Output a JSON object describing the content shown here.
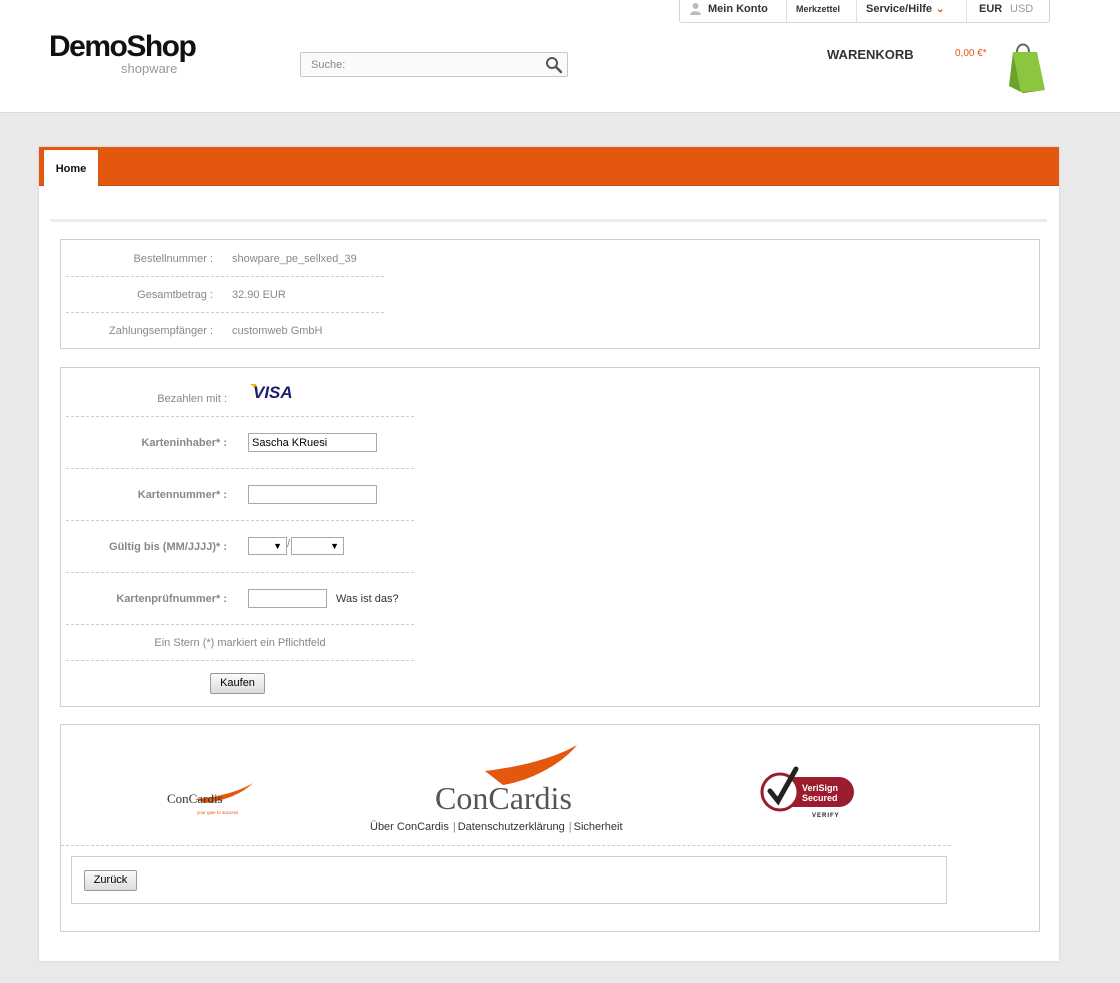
{
  "header": {
    "logo_main": "DemoShop",
    "logo_sub": "shopware",
    "search_placeholder": "Suche:",
    "account": "Mein Konto",
    "wishlist": "Merkzettel",
    "service": "Service/Hilfe",
    "currency_active": "EUR",
    "currency_other": "USD",
    "cart_label": "WARENKORB",
    "cart_amount": "0,00 €*"
  },
  "nav": {
    "home": "Home"
  },
  "order": {
    "rows": [
      {
        "label": "Bestellnummer :",
        "value": "showpare_pe_sellxed_39"
      },
      {
        "label": "Gesamtbetrag :",
        "value": "32.90 EUR"
      },
      {
        "label": "Zahlungsempfänger :",
        "value": "customweb GmbH"
      }
    ]
  },
  "payment": {
    "pay_with_label": "Bezahlen mit :",
    "card_brand": "VISA",
    "holder_label": "Karteninhaber* :",
    "holder_value": "Sascha KRuesi",
    "number_label": "Kartennummer* :",
    "number_value": "",
    "expiry_label": "Gültig bis (MM/JJJJ)* :",
    "expiry_month": "",
    "expiry_year": "",
    "expiry_separator": "/",
    "cvc_label": "Kartenprüfnummer* :",
    "cvc_value": "",
    "cvc_help": "Was ist das?",
    "required_note": "Ein Stern (*) markiert ein Pflichtfeld",
    "submit": "Kaufen"
  },
  "footer": {
    "concardis_small": "ConCardis",
    "concardis_tagline": "your gate to success",
    "concardis_large": "ConCardis",
    "verisign_line1": "VeriSign",
    "verisign_line2": "Secured",
    "verisign_verify": "VERIFY",
    "links": [
      "Über ConCardis",
      "Datenschutzerklärung",
      "Sicherheit"
    ],
    "back": "Zurück"
  },
  "colors": {
    "accent": "#e4570f",
    "bag": "#8cc63f",
    "visa": "#1a1f71"
  }
}
